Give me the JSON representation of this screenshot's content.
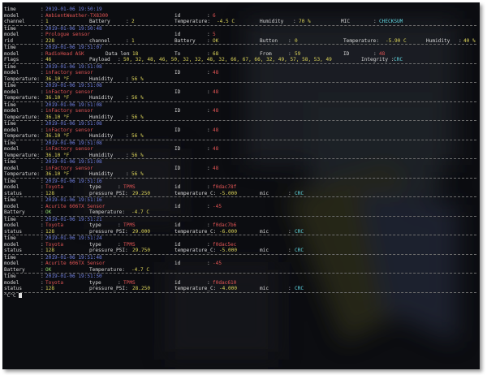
{
  "labels": {
    "time": "time",
    "model": "model",
    "channel": "channel",
    "rid": "rid",
    "flags": "Flags",
    "temperature": "Temperature:",
    "status": "status",
    "battery": "Battery",
    "id": "id",
    "type": "type",
    "mic": "mic",
    "id_upper": "ID",
    "humidity": "Humidity",
    "button": "Button",
    "to": "To",
    "from": "From",
    "integrity": "Integrity :",
    "payload": "Payload",
    "data_len": "Data len",
    "pressure": "pressure_PSI:",
    "temperature_c": "temperature_C:",
    "sep": ":"
  },
  "entries": [
    {
      "time": "2019-01-06 19:50:19",
      "model": "AmbientWeather-TX8300",
      "id": "6",
      "channel": "1",
      "battery": "2",
      "temperature": "-4.5 C",
      "humidity": "70 %",
      "mic_label": "MIC",
      "mic": "CHECKSUM"
    },
    {
      "time": "2019-01-06 19:50:48",
      "model": "Prologue sensor",
      "id": "5",
      "rid": "228",
      "channel": "1",
      "battery": "OK",
      "button": "0",
      "temperature": "-5.90 C",
      "humidity": "40 %"
    },
    {
      "time": "2019-01-06 19:51:07",
      "model": "RadioHead ASK",
      "data_len": "18",
      "to": "68",
      "from": "59",
      "id": "48",
      "flags": "46",
      "payload": "50, 32, 48, 46, 50, 32, 32, 48, 32, 66, 67, 66, 32, 49, 57, 58, 53, 49",
      "integrity": "CRC"
    },
    {
      "time": "2019-01-06 19:51:08",
      "model": "inFactory sensor",
      "id": "48",
      "temperature": "36.10 °F",
      "humidity": "56 %"
    },
    {
      "time": "2019-01-06 19:51:08",
      "model": "inFactory sensor",
      "id": "48",
      "temperature": "36.10 °F",
      "humidity": "56 %"
    },
    {
      "time": "2019-01-06 19:51:08",
      "model": "inFactory sensor",
      "id": "48",
      "temperature": "36.10 °F",
      "humidity": "56 %"
    },
    {
      "time": "2019-01-06 19:51:08",
      "model": "inFactory sensor",
      "id": "48",
      "temperature": "36.10 °F",
      "humidity": "56 %"
    },
    {
      "time": "2019-01-06 19:51:08",
      "model": "inFactory sensor",
      "id": "48",
      "temperature": "36.10 °F",
      "humidity": "56 %"
    },
    {
      "time": "2019-01-06 19:51:08",
      "model": "inFactory sensor",
      "id": "48",
      "temperature": "36.10 °F",
      "humidity": "56 %"
    },
    {
      "time": "2019-01-06 19:51:16",
      "model": "Toyota",
      "type": "TPMS",
      "id": "f0dac78f",
      "status": "128",
      "pressure": "29.250",
      "temperature_c": "-5.000",
      "mic": "CRC"
    },
    {
      "time": "2019-01-06 19:51:16",
      "model": "Acurite 606TX Sensor",
      "id": "-45",
      "battery": "OK",
      "temperature": "-4.7 C"
    },
    {
      "time": "2019-01-06 19:51:21",
      "model": "Toyota",
      "type": "TPMS",
      "id": "f0dac7b6",
      "status": "128",
      "pressure": "29.000",
      "temperature_c": "-6.000",
      "mic": "CRC"
    },
    {
      "time": "2019-01-06 19:51:24",
      "model": "Toyota",
      "type": "TPMS",
      "id": "f0dac5ec",
      "status": "128",
      "pressure": "29.750",
      "temperature_c": "-5.000",
      "mic": "CRC"
    },
    {
      "time": "2019-01-06 19:51:48",
      "model": "Acurite 606TX Sensor",
      "id": "-45",
      "battery": "OK",
      "temperature": "-4.7 C"
    },
    {
      "time": "2019-01-06 19:51:50",
      "model": "Toyota",
      "type": "TPMS",
      "id": "f0dac610",
      "status": "128",
      "pressure": "28.250",
      "temperature_c": "-4.000",
      "mic": "CRC"
    }
  ],
  "prompt": {
    "text": "^C^C"
  },
  "colors": {
    "time": "#6f7fe0",
    "model": "#e05454",
    "value": "#dcd45a",
    "green": "#8fd46a",
    "cyan": "#5fd6e0",
    "background": "#0c0d11"
  }
}
